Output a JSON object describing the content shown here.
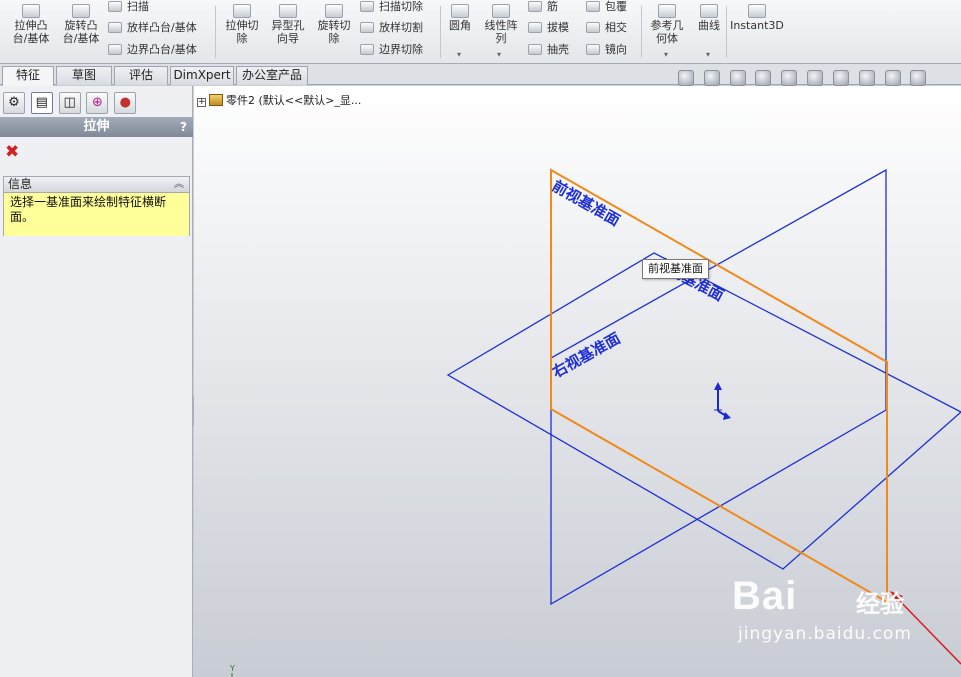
{
  "ribbon": {
    "extrude_boss": "拉伸凸\n台/基体",
    "revolve_boss": "旋转凸\n台/基体",
    "sweep": "扫描",
    "loft": "放样凸台/基体",
    "boundary_boss": "边界凸台/基体",
    "extrude_cut": "拉伸切\n除",
    "hole_wizard": "异型孔\n向导",
    "revolve_cut": "旋转切\n除",
    "swept_cut": "扫描切除",
    "lofted_cut": "放样切割",
    "boundary_cut": "边界切除",
    "fillet": "圆角",
    "linear_pattern": "线性阵\n列",
    "rib": "筋",
    "draft": "拔模",
    "shell": "抽壳",
    "wrap": "包覆",
    "intersect": "相交",
    "mirror": "镜向",
    "ref_geometry": "参考几\n何体",
    "curves": "曲线",
    "instant3d": "Instant3D"
  },
  "tabs": [
    {
      "label": "特征",
      "active": true
    },
    {
      "label": "草图",
      "active": false
    },
    {
      "label": "评估",
      "active": false
    },
    {
      "label": "DimXpert",
      "active": false
    },
    {
      "label": "办公室产品",
      "active": false
    }
  ],
  "property_manager": {
    "title": "拉伸",
    "help": "?",
    "close": "✖",
    "info_header": "信息",
    "info_collapse": "︽",
    "info_text": "选择一基准面来绘制特征横断面。"
  },
  "tree": {
    "root_label": "零件2  (默认<<默认>_显..."
  },
  "planes": {
    "front": "前视基准面",
    "top": "上视基准面",
    "right": "右视基准面"
  },
  "tooltip": "前视基准面",
  "axis_label": "Y",
  "watermark": {
    "brand": "Bai",
    "cn": "经验",
    "url": "jingyan.baidu.com"
  },
  "colors": {
    "plane_blue": "#1f2fd6",
    "plane_highlight": "#f08a1c",
    "accent_red": "#d61f1f"
  }
}
